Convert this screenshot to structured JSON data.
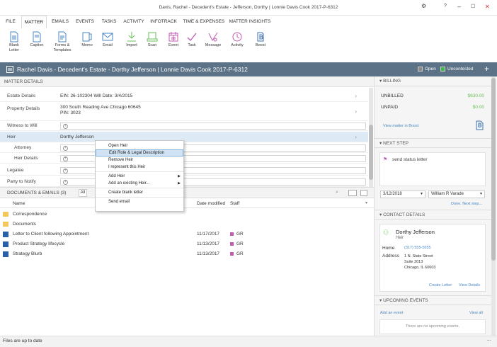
{
  "window": {
    "title": "Davis, Rachel - Decedent's Estate - Jefferson, Dorthy | Lonnie Davis Cook 2017-P-6312"
  },
  "menu_tabs": [
    "FILE",
    "MATTER",
    "EMAILS",
    "EVENTS",
    "TASKS",
    "ACTIVITY",
    "INFOTRACK",
    "TIME & EXPENSES",
    "MATTER INSIGHTS"
  ],
  "ribbon": [
    {
      "label": "Blank\nLetter",
      "icon": "letter-icon"
    },
    {
      "label": "Caption",
      "icon": "caption-icon"
    },
    {
      "label": "Forms &\nTemplates",
      "icon": "forms-icon"
    },
    {
      "label": "Memo",
      "icon": "memo-icon"
    },
    {
      "label": "Email",
      "icon": "email-icon"
    },
    {
      "label": "Import",
      "icon": "import-icon"
    },
    {
      "label": "Scan",
      "icon": "scan-icon"
    },
    {
      "label": "Event",
      "icon": "calendar-icon"
    },
    {
      "label": "Task",
      "icon": "task-icon"
    },
    {
      "label": "Message",
      "icon": "message-icon"
    },
    {
      "label": "Activity",
      "icon": "activity-icon"
    },
    {
      "label": "Boost",
      "icon": "boost-icon"
    }
  ],
  "matter_header": {
    "title": "Rachel Davis - Decedent's Estate - Dorthy Jefferson | Lonnie Davis Cook 2017-P-6312",
    "legend_open": "Open",
    "legend_uncontested": "Uncontested",
    "add": "+",
    "colors": {
      "open": "#8a8a8a",
      "uncontested": "#3dbb4a"
    }
  },
  "matter_details": {
    "header": "MATTER DETAILS",
    "rows": [
      {
        "label": "Estate Details",
        "value": "EIN: 26-102304  Will Date: 3/4/2015"
      },
      {
        "label": "Property Details",
        "value": "300 South Reading Ave Chicago 60645",
        "value2": "PIN: 3023"
      },
      {
        "label": "Witness to Will",
        "value": ""
      },
      {
        "label": "Heir",
        "value": "Dorthy Jefferson"
      },
      {
        "label": "Attorney",
        "value": ""
      },
      {
        "label": "Heir Details",
        "value": ""
      },
      {
        "label": "Legatee",
        "value": ""
      },
      {
        "label": "Party to Notify",
        "value": ""
      }
    ]
  },
  "context_menu": {
    "items": [
      "Open Heir",
      "Edit Role & Legal Description",
      "Remove Heir",
      "I represent this Heir",
      "Add Heir",
      "Add an existing Heir...",
      "Create blank letter",
      "Send email"
    ]
  },
  "documents": {
    "header": "DOCUMENTS & EMAILS (3)",
    "filter_all": "All",
    "columns": {
      "name": "Name",
      "date": "Date modified",
      "staff": "Staff"
    },
    "folders": [
      "Correspondence",
      "Documents"
    ],
    "files": [
      {
        "name": "Letter to Client following Appointment",
        "date": "11/17/2017",
        "staff": "GR"
      },
      {
        "name": "Product Strategy lifecycle",
        "date": "11/13/2017",
        "staff": "GR"
      },
      {
        "name": "Strategy Blurb",
        "date": "11/13/2017",
        "staff": "GR"
      }
    ]
  },
  "status_bar": {
    "text": "Files are up to date",
    "dots": "..."
  },
  "billing": {
    "header": "BILLING",
    "unbilled_label": "UNBILLED",
    "unbilled_value": "$630.00",
    "unpaid_label": "UNPAID",
    "unpaid_value": "$0.00",
    "link": "View matter in Boost"
  },
  "next_step": {
    "header": "NEXT STEP",
    "text": "send status letter",
    "date": "3/12/2018",
    "staff": "William R Varade",
    "done": "Done. Next step..."
  },
  "contact": {
    "header": "CONTACT DETAILS",
    "name": "Dorthy Jefferson",
    "role": "Heir",
    "home_label": "Home",
    "home_value": "(317) 555-5555",
    "address_label": "Address",
    "address_lines": [
      "1 N. State Street",
      "Suite 2013",
      "Chicago, IL 60603"
    ],
    "create_letter": "Create Letter",
    "view_details": "View Details"
  },
  "events": {
    "header": "UPCOMING EVENTS",
    "add": "Add an event",
    "view_all": "View all",
    "empty": "There are no upcoming events."
  }
}
